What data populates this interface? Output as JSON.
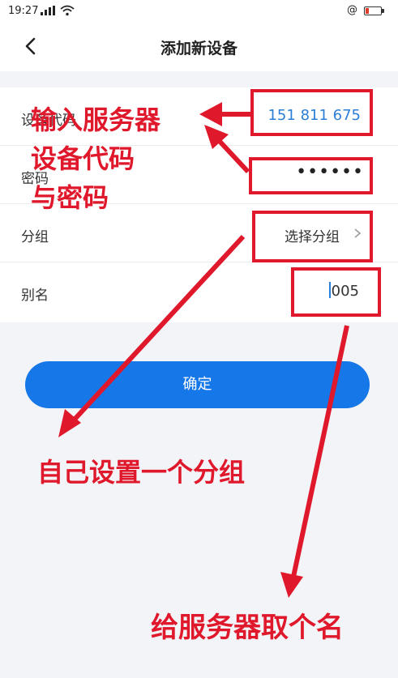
{
  "status_bar": {
    "time": "19:27",
    "signal": "∙∙ıl",
    "at_icon": "@"
  },
  "battery_level_percent": 25,
  "header": {
    "title": "添加新设备",
    "back_icon": "chevron-left-icon"
  },
  "form": {
    "device_code": {
      "label": "设备代码",
      "value": "151 811 675"
    },
    "password": {
      "label": "密码",
      "value": "••••••"
    },
    "group": {
      "label": "分组",
      "placeholder": "选择分组",
      "chevron_icon": "chevron-right-icon"
    },
    "alias": {
      "label": "别名",
      "value": "005"
    }
  },
  "confirm_label": "确定",
  "annotations": {
    "line1": "输入服务器",
    "line2": "设备代码",
    "line3": "与密码",
    "group_hint": "自己设置一个分组",
    "alias_hint": "给服务器取个名"
  },
  "colors": {
    "accent": "#1677e8",
    "annotation_red": "#e0182b",
    "value_blue": "#2b7fd6",
    "background": "#f3f4f8"
  }
}
